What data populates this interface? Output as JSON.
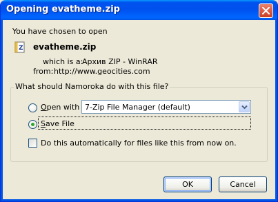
{
  "window": {
    "title": "Opening evatheme.zip"
  },
  "content": {
    "intro": "You have chosen to open",
    "filename": "evatheme.zip",
    "which_is_label": "which is a:",
    "which_is_value": "Архив ZIP - WinRAR",
    "from_label": "from:",
    "from_value": "http://www.geocities.com"
  },
  "group": {
    "legend": "What should Namoroka do with this file?",
    "open_with_key": "O",
    "open_with_rest": "pen with",
    "open_with_app": "7-Zip File Manager (default)",
    "save_key": "S",
    "save_rest": "ave File",
    "selected": "save",
    "auto_label": "Do this automatically for files like this from now on.",
    "auto_checked": false
  },
  "buttons": {
    "ok": "OK",
    "cancel": "Cancel"
  },
  "colors": {
    "title_bar": "#0055e5",
    "dialog_bg": "#ece9d8",
    "close_button": "#e2614a",
    "radio_dot": "#2fa72b"
  },
  "icons": {
    "file": "zip-archive-icon",
    "close": "close-icon",
    "dropdown": "chevron-down-icon"
  }
}
